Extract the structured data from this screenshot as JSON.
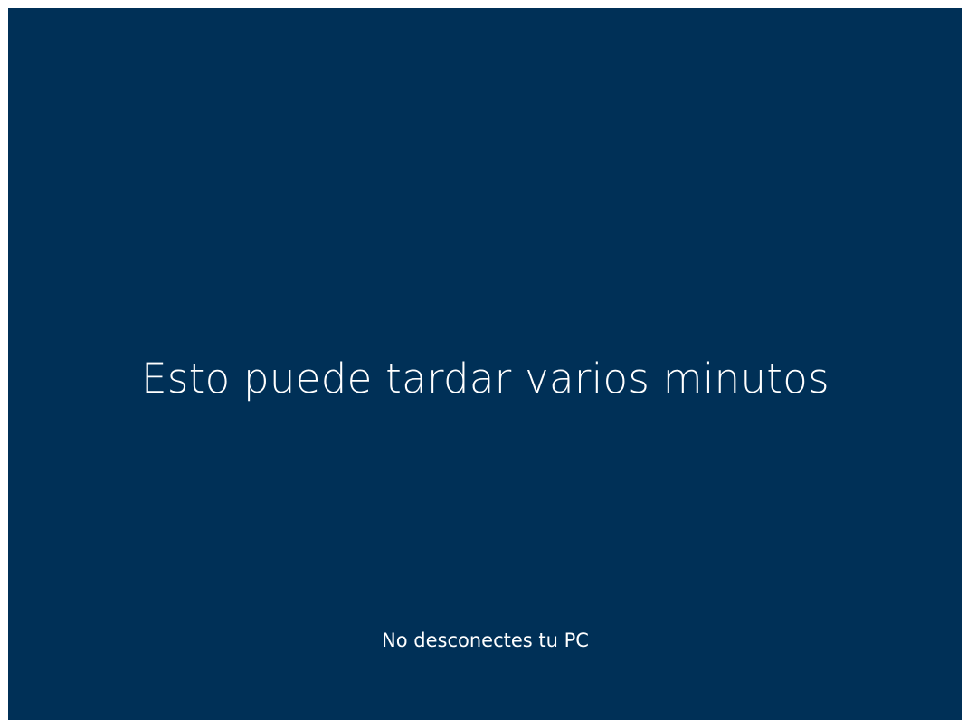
{
  "screen": {
    "background_color": "#003057",
    "text_color": "#ffffff",
    "main_message": "Esto puede tardar varios minutos",
    "sub_message": "No desconectes tu PC"
  }
}
